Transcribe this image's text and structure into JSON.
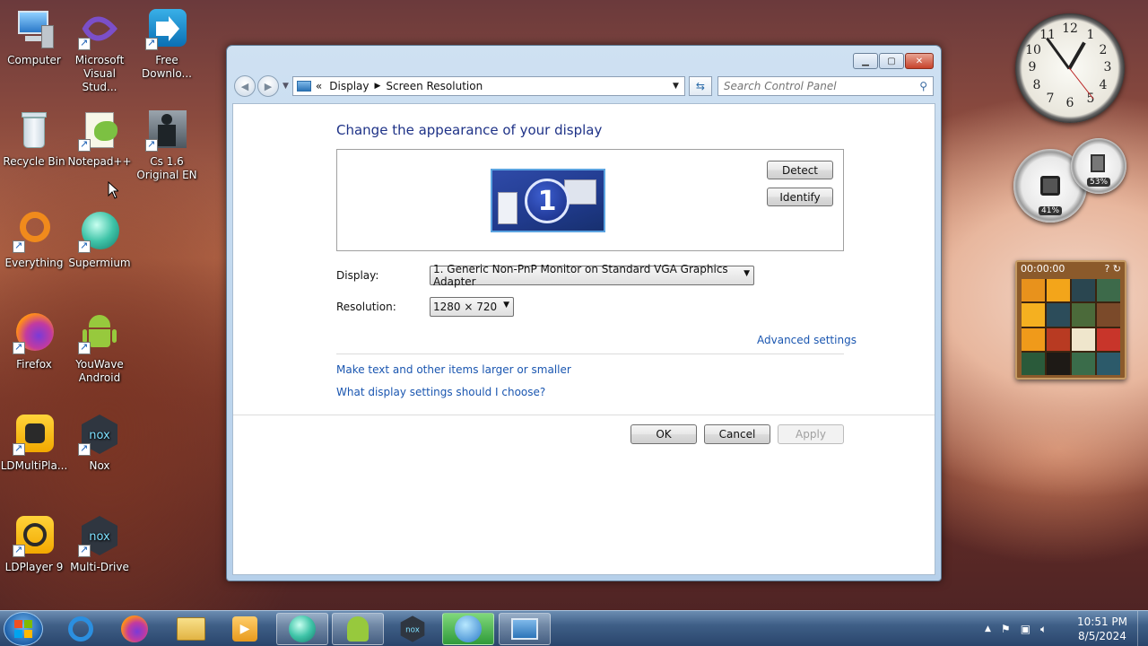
{
  "desktop": {
    "icons": [
      {
        "label": "Computer",
        "icon": "computer-icon"
      },
      {
        "label": "Microsoft Visual Stud...",
        "icon": "visual-studio-icon"
      },
      {
        "label": "Free Downlo...",
        "icon": "free-download-manager-icon"
      },
      {
        "label": "Recycle Bin",
        "icon": "recycle-bin-icon"
      },
      {
        "label": "Notepad++",
        "icon": "notepad-plus-plus-icon"
      },
      {
        "label": "Cs 1.6 Original EN",
        "icon": "counter-strike-icon"
      },
      {
        "label": "Everything",
        "icon": "everything-search-icon"
      },
      {
        "label": "Supermium",
        "icon": "supermium-browser-icon"
      },
      {
        "label": "Firefox",
        "icon": "firefox-icon"
      },
      {
        "label": "YouWave Android",
        "icon": "android-icon"
      },
      {
        "label": "LDMultiPla...",
        "icon": "ldmultiplayer-icon"
      },
      {
        "label": "Nox",
        "icon": "nox-icon"
      },
      {
        "label": "LDPlayer 9",
        "icon": "ldplayer-icon"
      },
      {
        "label": "Multi-Drive",
        "icon": "nox-multidrive-icon"
      }
    ]
  },
  "gadgets": {
    "clock_numbers": [
      "12",
      "1",
      "2",
      "3",
      "4",
      "5",
      "6",
      "7",
      "8",
      "9",
      "10",
      "11"
    ],
    "cpu_percent": "41%",
    "memory_percent": "53%",
    "puzzle_timer": "00:00:00"
  },
  "window": {
    "breadcrumb": {
      "root": "Display",
      "current": "Screen Resolution",
      "separator": "«"
    },
    "search_placeholder": "Search Control Panel",
    "title": "Change the appearance of your display",
    "monitor_number": "1",
    "detect_label": "Detect",
    "identify_label": "Identify",
    "display_label": "Display:",
    "display_value": "1. Generic Non-PnP Monitor on Standard VGA Graphics Adapter",
    "resolution_label": "Resolution:",
    "resolution_value": "1280 × 720",
    "advanced_link": "Advanced settings",
    "link_text_size": "Make text and other items larger or smaller",
    "link_help": "What display settings should I choose?",
    "ok_label": "OK",
    "cancel_label": "Cancel",
    "apply_label": "Apply"
  },
  "taskbar": {
    "items": [
      {
        "icon": "internet-explorer-icon"
      },
      {
        "icon": "firefox-icon"
      },
      {
        "icon": "file-explorer-icon"
      },
      {
        "icon": "media-player-icon"
      },
      {
        "icon": "supermium-browser-icon"
      },
      {
        "icon": "android-icon"
      },
      {
        "icon": "nox-icon"
      },
      {
        "icon": "download-manager-icon"
      },
      {
        "icon": "control-panel-icon"
      }
    ],
    "time": "10:51 PM",
    "date": "8/5/2024"
  },
  "colors": {
    "title_blue": "#1e3287",
    "link_blue": "#1a56b0"
  }
}
